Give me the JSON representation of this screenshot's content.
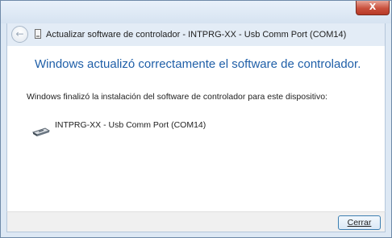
{
  "window": {
    "close_glyph": "X",
    "title": "Actualizar software de controlador - INTPRG-XX - Usb Comm Port (COM14)"
  },
  "nav": {
    "back_glyph": "←"
  },
  "content": {
    "heading": "Windows actualizó correctamente el software de controlador.",
    "message": "Windows finalizó la instalación del software de controlador para este dispositivo:",
    "device_name": "INTPRG-XX - Usb Comm Port (COM14)"
  },
  "footer": {
    "close_label": "Cerrar"
  },
  "colors": {
    "heading": "#1f5fa8",
    "close_button_red": "#c9503d",
    "button_border": "#3c7fb1"
  }
}
